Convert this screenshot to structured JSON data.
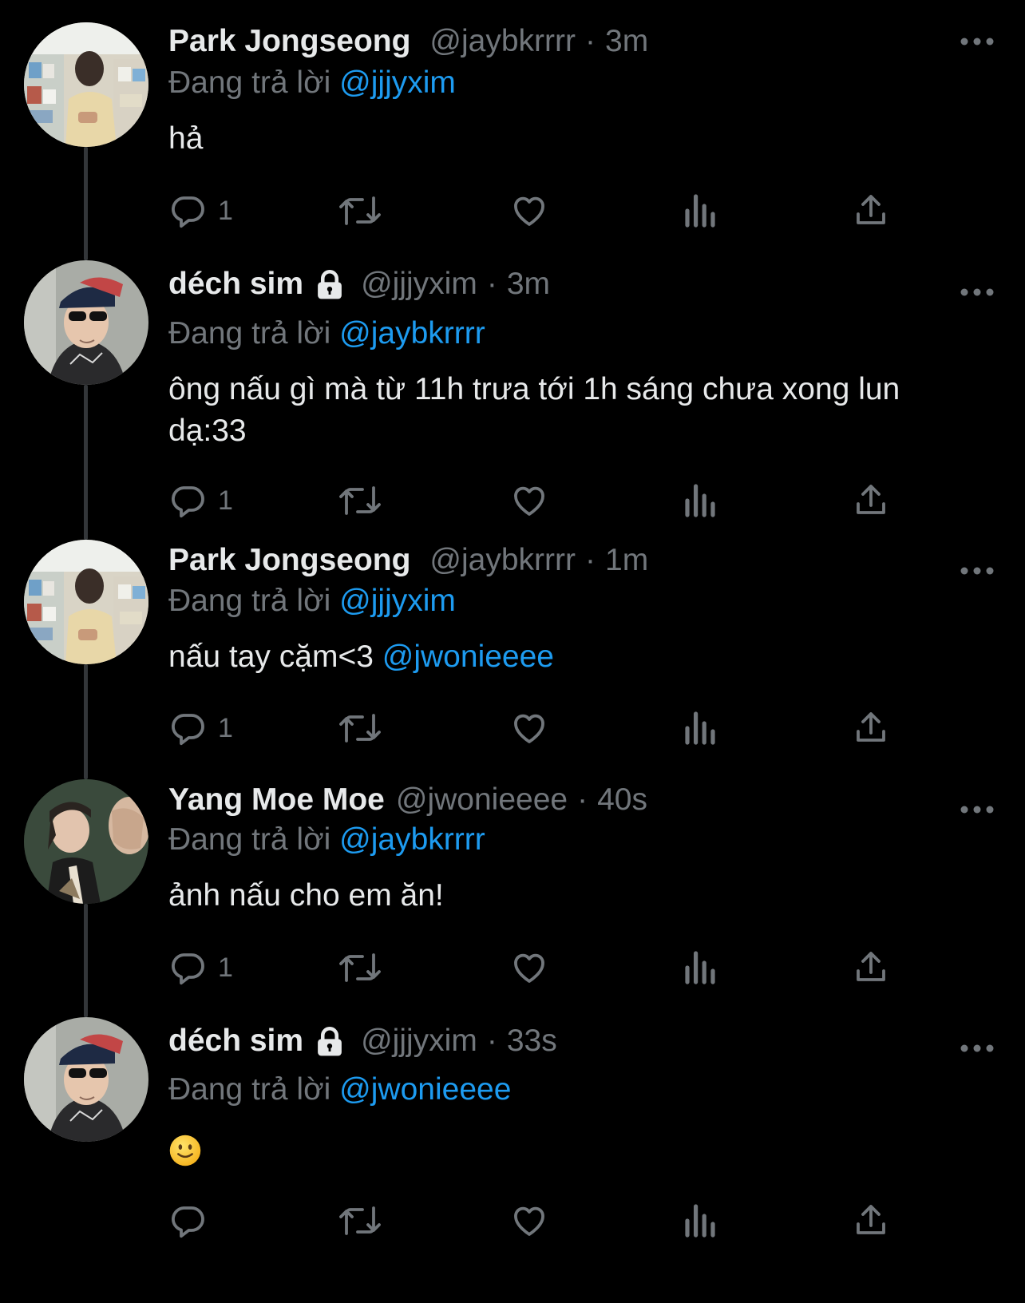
{
  "reply_prefix": "Đang trả lời",
  "tweets": [
    {
      "display_name": "Park Jongseong",
      "handle": "@jaybkrrrr",
      "separator": "·",
      "time": "3m",
      "reply_to": "@jjjyxim",
      "text": "hả",
      "reply_count": "1",
      "avatar": "avatar-store-photo"
    },
    {
      "display_name": "déch sim",
      "protected": true,
      "handle": "@jjjyxim",
      "separator": "·",
      "time": "3m",
      "reply_to": "@jaybkrrrr",
      "text": "ông nấu gì mà từ 11h trưa tới 1h sáng chưa xong lun dạ:33",
      "reply_count": "1",
      "avatar": "avatar-sunglasses-photo"
    },
    {
      "display_name": "Park Jongseong",
      "handle": "@jaybkrrrr",
      "separator": "·",
      "time": "1m",
      "reply_to": "@jjjyxim",
      "text": "nấu tay cặm<3",
      "mention": "@jwonieeee",
      "reply_count": "1",
      "avatar": "avatar-store-photo"
    },
    {
      "display_name": "Yang Moe Moe",
      "handle": "@jwonieeee",
      "separator": "·",
      "time": "40s",
      "reply_to": "@jaybkrrrr",
      "text": "ảnh nấu cho em ăn!",
      "reply_count": "1",
      "avatar": "avatar-fist-photo"
    },
    {
      "display_name": "déch sim",
      "protected": true,
      "handle": "@jjjyxim",
      "separator": "·",
      "time": "33s",
      "reply_to": "@jwonieeee",
      "text": "",
      "emoji": "slightly-smiling-face",
      "reply_count": "",
      "avatar": "avatar-sunglasses-photo"
    }
  ],
  "icons": {
    "reply": "reply-icon",
    "retweet": "retweet-icon",
    "like": "heart-icon",
    "views": "views-icon",
    "share": "share-icon",
    "more": "more-icon",
    "lock": "lock-icon"
  },
  "colors": {
    "background": "#000000",
    "text": "#e7e9ea",
    "secondary": "#71767b",
    "link": "#1d9bf0",
    "thread_line": "#333639"
  }
}
